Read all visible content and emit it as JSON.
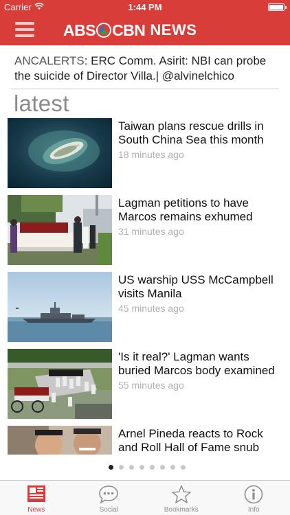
{
  "status_bar": {
    "carrier": "Carrier",
    "time": "1:44 PM"
  },
  "header": {
    "logo_text_left": "ABS",
    "logo_text_right": "CBN",
    "logo_text_news": "NEWS",
    "brand_color": "#d93d3a"
  },
  "breaking": {
    "source": "ANCALERTS",
    "text": ": ERC Comm. Asirit: NBI can probe the suicide of Director Villa.| @alvinelchico"
  },
  "section": {
    "title": "latest"
  },
  "articles": [
    {
      "headline": "Taiwan plans rescue drills in South China Sea this month",
      "time": "18 minutes ago"
    },
    {
      "headline": "Lagman petitions to have Marcos remains exhumed",
      "time": "31 minutes ago"
    },
    {
      "headline": "US warship USS McCampbell visits Manila",
      "time": "45 minutes ago"
    },
    {
      "headline": "'Is it real?' Lagman wants buried Marcos body examined",
      "time": "55 minutes ago"
    },
    {
      "headline": "Arnel Pineda reacts to Rock and Roll Hall of Fame snub",
      "time": ""
    }
  ],
  "pager": {
    "pages": 8,
    "current": 1
  },
  "tabs": [
    {
      "label": "News",
      "icon": "news-icon",
      "active": true
    },
    {
      "label": "Social",
      "icon": "speech-bubble-icon",
      "active": false
    },
    {
      "label": "Bookmarks",
      "icon": "star-icon",
      "active": false
    },
    {
      "label": "Info",
      "icon": "info-icon",
      "active": false
    }
  ]
}
